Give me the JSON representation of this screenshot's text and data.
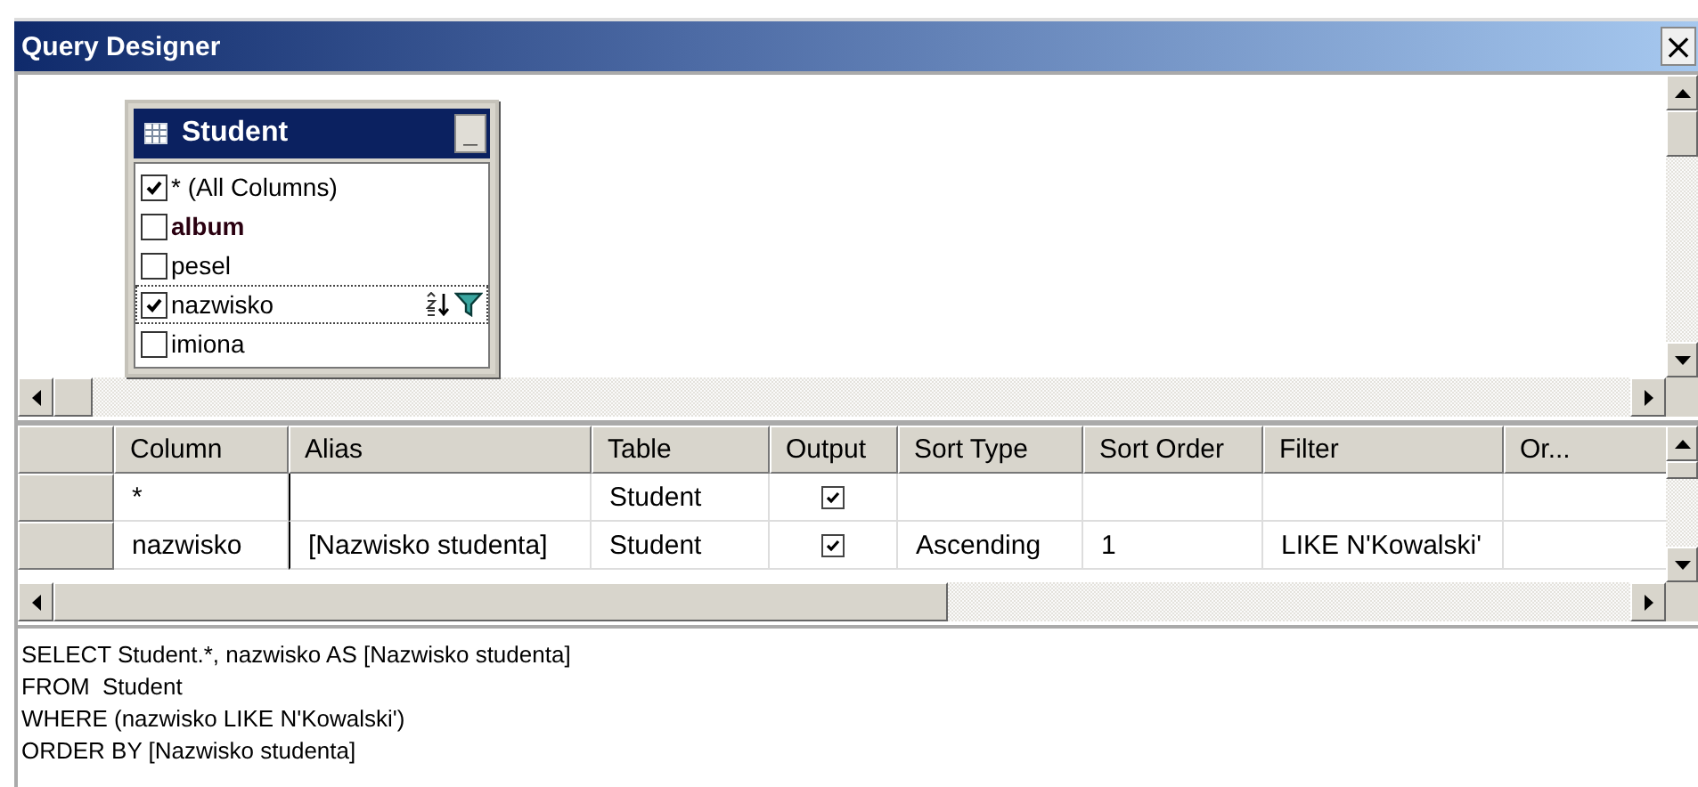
{
  "window": {
    "title": "Query Designer",
    "close": "×"
  },
  "diagram": {
    "table": {
      "name": "Student",
      "collapse": "_",
      "columns": [
        {
          "name": "* (All Columns)",
          "checked": true,
          "primary_key": false,
          "sorted": false,
          "filtered": false,
          "focused": false
        },
        {
          "name": "album",
          "checked": false,
          "primary_key": true,
          "sorted": false,
          "filtered": false,
          "focused": false
        },
        {
          "name": "pesel",
          "checked": false,
          "primary_key": false,
          "sorted": false,
          "filtered": false,
          "focused": false
        },
        {
          "name": "nazwisko",
          "checked": true,
          "primary_key": false,
          "sorted": true,
          "filtered": true,
          "focused": true
        },
        {
          "name": "imiona",
          "checked": false,
          "primary_key": false,
          "sorted": false,
          "filtered": false,
          "focused": false
        }
      ]
    }
  },
  "grid": {
    "columns": [
      "Column",
      "Alias",
      "Table",
      "Output",
      "Sort Type",
      "Sort Order",
      "Filter",
      "Or..."
    ],
    "rows": [
      {
        "column": "*",
        "alias": "",
        "table": "Student",
        "output": true,
        "sort_type": "",
        "sort_order": "",
        "filter": "",
        "or": ""
      },
      {
        "column": "nazwisko",
        "alias": "[Nazwisko studenta]",
        "table": "Student",
        "output": true,
        "sort_type": "Ascending",
        "sort_order": "1",
        "filter": "LIKE N'Kowalski'",
        "or": ""
      }
    ]
  },
  "sql": [
    "SELECT Student.*, nazwisko AS [Nazwisko studenta]",
    "FROM  Student",
    "WHERE (nazwisko LIKE N'Kowalski')",
    "ORDER BY [Nazwisko studenta]"
  ]
}
